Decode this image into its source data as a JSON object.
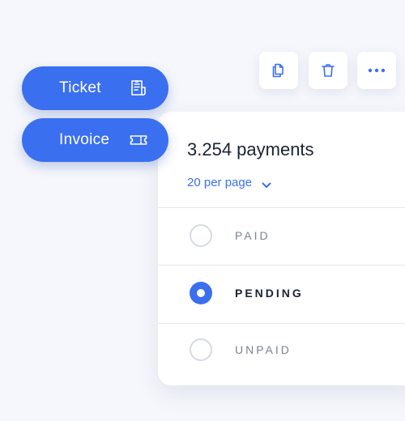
{
  "toolbar": {
    "buttons": [
      {
        "icon": "copy-icon"
      },
      {
        "icon": "trash-icon"
      },
      {
        "icon": "more-icon"
      }
    ]
  },
  "actions": {
    "ticket": {
      "label": "Ticket",
      "icon": "receipt-icon"
    },
    "invoice": {
      "label": "Invoice",
      "icon": "ticket-icon"
    }
  },
  "payments": {
    "title": "3.254 payments",
    "per_page": "20 per page",
    "options": [
      {
        "label": "PAID",
        "selected": false
      },
      {
        "label": "PENDING",
        "selected": true
      },
      {
        "label": "UNPAID",
        "selected": false
      }
    ]
  },
  "colors": {
    "accent": "#3a6ff0",
    "background": "#f5f7fc",
    "text_dark": "#1a2233",
    "text_muted": "#7a8394"
  }
}
